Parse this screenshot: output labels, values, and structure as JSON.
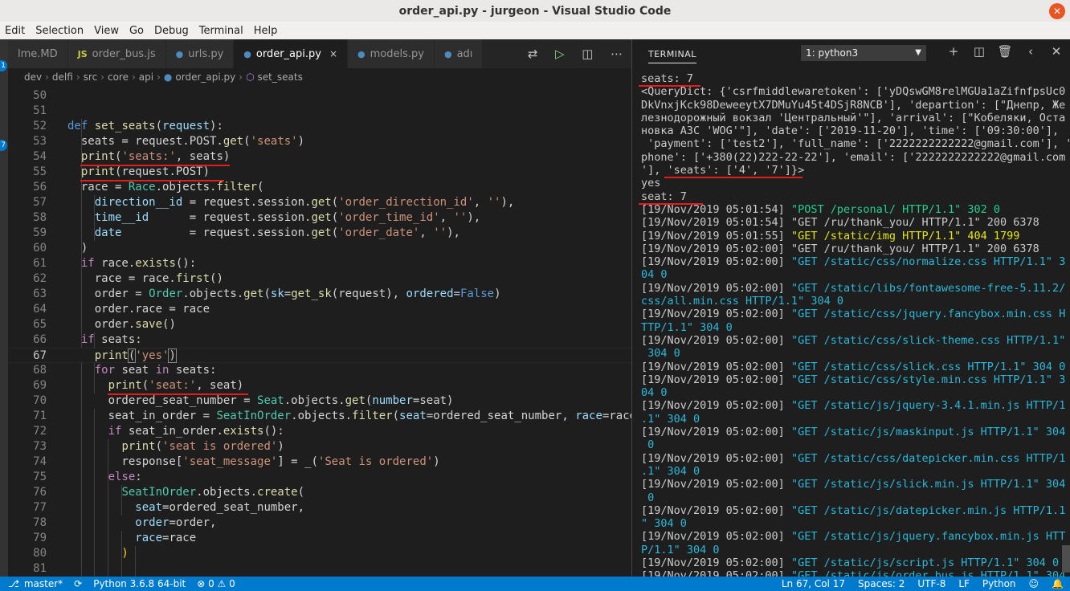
{
  "window": {
    "title": "order_api.py - jurgeon - Visual Studio Code",
    "close_glyph": "✕"
  },
  "menu": [
    "Edit",
    "Selection",
    "View",
    "Go",
    "Debug",
    "Terminal",
    "Help"
  ],
  "activity": {
    "badge_1": "1",
    "badge_2": "7"
  },
  "tabs": [
    {
      "label": "lme.MD",
      "icon": "",
      "active": false
    },
    {
      "label": "order_bus.js",
      "icon": "JS",
      "active": false
    },
    {
      "label": "urls.py",
      "icon": "py",
      "active": false
    },
    {
      "label": "order_api.py",
      "icon": "py",
      "active": true,
      "close": "×"
    },
    {
      "label": "models.py",
      "icon": "py",
      "active": false
    },
    {
      "label": "adı",
      "icon": "py",
      "active": false
    }
  ],
  "breadcrumb": [
    "dev",
    "delfi",
    "src",
    "core",
    "api",
    "order_api.py",
    "set_seats"
  ],
  "code": {
    "line_numbers": [
      "50",
      "51",
      "52",
      "53",
      "54",
      "55",
      "56",
      "57",
      "58",
      "59",
      "60",
      "61",
      "62",
      "63",
      "64",
      "65",
      "66",
      "67",
      "68",
      "69",
      "70",
      "71",
      "72",
      "73",
      "74",
      "75",
      "76",
      "77",
      "78",
      "79",
      "80",
      "81",
      "82"
    ],
    "current_line": "67"
  },
  "panel": {
    "tab": "TERMINAL",
    "select": "1: python3",
    "select_caret": "▼",
    "icons": [
      "plus-icon",
      "split-icon",
      "trash-icon",
      "chevron-left-icon",
      "close-icon"
    ],
    "glyphs": [
      "+",
      "◫",
      "🗑",
      "‹",
      "✕"
    ]
  },
  "terminal": [
    "seats: 7",
    "<QueryDict: {'csrfmiddlewaretoken': ['yDQswGM8relMGUa1aZifnfpsUc0",
    "DkVnxjKck98DeweeytX7DMuYu45t4DSjR8NCB'], 'departion': [\"Днепр, Же",
    "лезнодорожный вокзал 'Центральный'\"], 'arrival': [\"Кобеляки, Оста",
    "новка АЗС 'WOG'\"], 'date': ['2019-11-20'], 'time': ['09:30:00'],",
    " 'payment': ['test2'], 'full_name': ['2222222222222@gmail.com'], '",
    "phone': ['+380(22)222-22-22'], 'email': ['2222222222222@gmail.com",
    "'], 'seats': ['4', '7']}>",
    "yes",
    "seat: 7"
  ],
  "logs": [
    {
      "ts": "[19/Nov/2019 05:01:54]",
      "msg": "\"POST /personal/ HTTP/1.1\" 302 0",
      "color": "g",
      "cont": ""
    },
    {
      "ts": "[19/Nov/2019 05:01:54]",
      "msg": "\"GET /ru/thank_you/ HTTP/1.1\" 200 6378",
      "color": "w",
      "cont": ""
    },
    {
      "ts": "[19/Nov/2019 05:01:55]",
      "msg": "\"GET /static/img HTTP/1.1\" 404 1799",
      "color": "y",
      "cont": ""
    },
    {
      "ts": "[19/Nov/2019 05:02:00]",
      "msg": "\"GET /ru/thank_you/ HTTP/1.1\" 200 6378",
      "color": "w",
      "cont": ""
    },
    {
      "ts": "[19/Nov/2019 05:02:00]",
      "msg": "\"GET /static/css/normalize.css HTTP/1.1\" 3",
      "color": "b",
      "cont": "04 0"
    },
    {
      "ts": "[19/Nov/2019 05:02:00]",
      "msg": "\"GET /static/libs/fontawesome-free-5.11.2/",
      "color": "b",
      "cont": "css/all.min.css HTTP/1.1\" 304 0"
    },
    {
      "ts": "[19/Nov/2019 05:02:00]",
      "msg": "\"GET /static/css/jquery.fancybox.min.css H",
      "color": "b",
      "cont": "TTP/1.1\" 304 0"
    },
    {
      "ts": "[19/Nov/2019 05:02:00]",
      "msg": "\"GET /static/css/slick-theme.css HTTP/1.1\"",
      "color": "b",
      "cont": " 304 0"
    },
    {
      "ts": "[19/Nov/2019 05:02:00]",
      "msg": "\"GET /static/css/slick.css HTTP/1.1\" 304 0",
      "color": "b",
      "cont": ""
    },
    {
      "ts": "[19/Nov/2019 05:02:00]",
      "msg": "\"GET /static/css/style.min.css HTTP/1.1\" 3",
      "color": "b",
      "cont": "04 0"
    },
    {
      "ts": "[19/Nov/2019 05:02:00]",
      "msg": "\"GET /static/js/jquery-3.4.1.min.js HTTP/1",
      "color": "b",
      "cont": ".1\" 304 0"
    },
    {
      "ts": "[19/Nov/2019 05:02:00]",
      "msg": "\"GET /static/js/maskinput.js HTTP/1.1\" 304",
      "color": "b",
      "cont": " 0"
    },
    {
      "ts": "[19/Nov/2019 05:02:00]",
      "msg": "\"GET /static/css/datepicker.min.css HTTP/1",
      "color": "b",
      "cont": ".1\" 304 0"
    },
    {
      "ts": "[19/Nov/2019 05:02:00]",
      "msg": "\"GET /static/js/slick.min.js HTTP/1.1\" 304",
      "color": "b",
      "cont": " 0"
    },
    {
      "ts": "[19/Nov/2019 05:02:00]",
      "msg": "\"GET /static/js/datepicker.min.js HTTP/1.1",
      "color": "b",
      "cont": "\" 304 0"
    },
    {
      "ts": "[19/Nov/2019 05:02:00]",
      "msg": "\"GET /static/js/jquery.fancybox.min.js HTT",
      "color": "b",
      "cont": "P/1.1\" 304 0"
    },
    {
      "ts": "[19/Nov/2019 05:02:00]",
      "msg": "\"GET /static/js/script.js HTTP/1.1\" 304 0",
      "color": "b",
      "cont": ""
    },
    {
      "ts": "[19/Nov/2019 05:02:00]",
      "msg": "\"GET /static/js/order_bus.js HTTP/1.1\" 304",
      "color": "b",
      "cont": ""
    }
  ],
  "status": {
    "branch": "master*",
    "python": "Python 3.6.8 64-bit",
    "problems": "⊗ 0 ⚠ 0",
    "position": "Ln 67, Col 17",
    "spaces": "Spaces: 2",
    "encoding": "UTF-8",
    "eol": "LF",
    "language": "Python"
  },
  "colors": {
    "accent": "#007acc",
    "underline": "#e51c1c"
  }
}
